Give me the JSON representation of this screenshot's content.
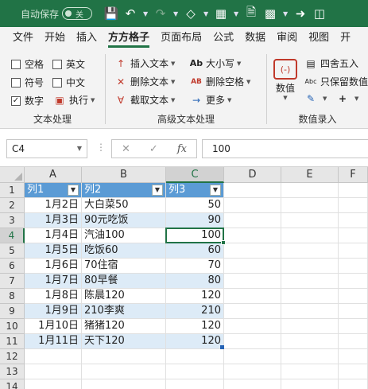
{
  "titlebar": {
    "autosave_label": "自动保存",
    "toggle_label": "关"
  },
  "tabs": [
    "文件",
    "开始",
    "插入",
    "方方格子",
    "页面布局",
    "公式",
    "数据",
    "审阅",
    "视图",
    "开"
  ],
  "active_tab": "方方格子",
  "ribbon": {
    "text_group": {
      "title": "文本处理",
      "checkboxes": [
        {
          "label": "空格",
          "checked": false
        },
        {
          "label": "英文",
          "checked": false
        },
        {
          "label": "符号",
          "checked": false
        },
        {
          "label": "中文",
          "checked": false
        },
        {
          "label": "数字",
          "checked": true
        }
      ],
      "exec_label": "执行"
    },
    "adv_group": {
      "title": "高级文本处理",
      "insert_text": "插入文本",
      "delete_text": "删除文本",
      "extract_text": "截取文本",
      "case_label": "大小写",
      "delete_space": "删除空格",
      "more": "更多"
    },
    "num_group": {
      "title": "数值录入",
      "numvalue": "数值",
      "round": "四舍五入",
      "keep_value": "只保留数值"
    }
  },
  "formula_bar": {
    "name_box": "C4",
    "value": "100",
    "fx": "fx"
  },
  "sheet": {
    "columns": [
      "A",
      "B",
      "C",
      "D",
      "E",
      "F"
    ],
    "selected_column": "C",
    "selected_row": "4",
    "rows": [
      "1",
      "2",
      "3",
      "4",
      "5",
      "6",
      "7",
      "8",
      "9",
      "10",
      "11",
      "12",
      "13",
      "14"
    ],
    "table_header": [
      "列1",
      "列2",
      "列3"
    ],
    "table_rows": [
      [
        "1月2日",
        "大白菜50",
        "50"
      ],
      [
        "1月3日",
        "90元吃饭",
        "90"
      ],
      [
        "1月4日",
        "汽油100",
        "100"
      ],
      [
        "1月5日",
        "吃饭60",
        "60"
      ],
      [
        "1月6日",
        "70住宿",
        "70"
      ],
      [
        "1月7日",
        "80早餐",
        "80"
      ],
      [
        "1月8日",
        "陈晨120",
        "120"
      ],
      [
        "1月9日",
        "210李爽",
        "210"
      ],
      [
        "1月10日",
        "猪猪120",
        "120"
      ],
      [
        "1月11日",
        "天下120",
        "120"
      ]
    ]
  }
}
